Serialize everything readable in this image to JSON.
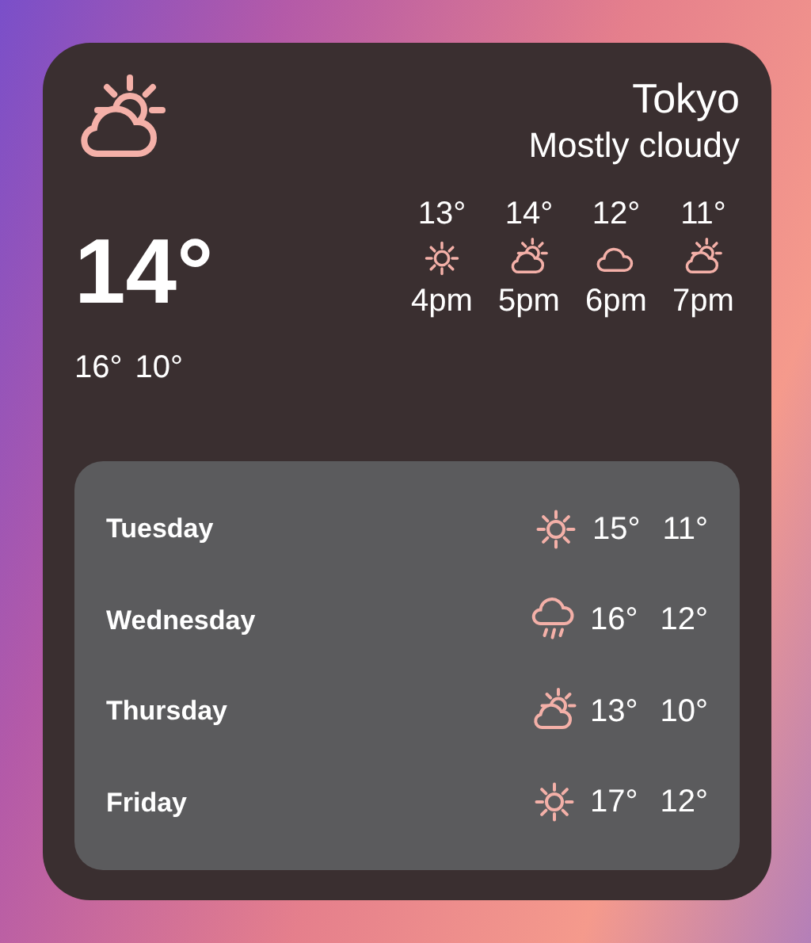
{
  "header": {
    "kind": "partly-cloudy",
    "city": "Tokyo",
    "condition": "Mostly cloudy"
  },
  "current": {
    "temp": "14°",
    "high": "16°",
    "low": "10°"
  },
  "hourly": [
    {
      "temp": "13°",
      "kind": "sunny",
      "time": "4pm"
    },
    {
      "temp": "14°",
      "kind": "partly-cloudy",
      "time": "5pm"
    },
    {
      "temp": "12°",
      "kind": "cloudy",
      "time": "6pm"
    },
    {
      "temp": "11°",
      "kind": "partly-cloudy",
      "time": "7pm"
    }
  ],
  "daily": [
    {
      "day": "Tuesday",
      "kind": "sunny",
      "high": "15°",
      "low": "11°"
    },
    {
      "day": "Wednesday",
      "kind": "rain",
      "high": "16°",
      "low": "12°"
    },
    {
      "day": "Thursday",
      "kind": "partly-cloudy",
      "high": "13°",
      "low": "10°"
    },
    {
      "day": "Friday",
      "kind": "sunny",
      "high": "17°",
      "low": "12°"
    }
  ]
}
